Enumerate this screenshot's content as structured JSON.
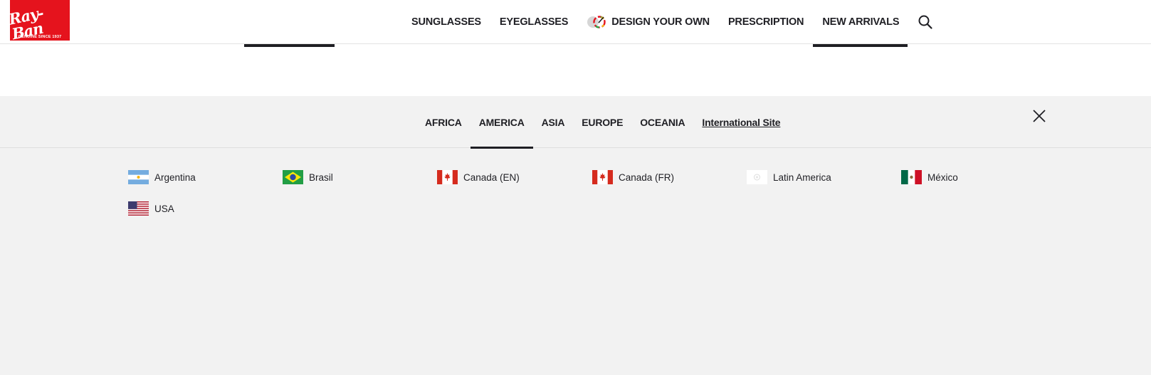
{
  "header": {
    "logo": {
      "script": "Ray-Ban",
      "tagline": "GENUINE SINCE 1937"
    },
    "nav": [
      {
        "label": "SUNGLASSES"
      },
      {
        "label": "EYEGLASSES"
      },
      {
        "label": "DESIGN YOUR OWN",
        "icon": "design-your-own-icon"
      },
      {
        "label": "PRESCRIPTION"
      },
      {
        "label": "NEW ARRIVALS"
      }
    ],
    "search_icon": "search-icon"
  },
  "region_panel": {
    "tabs": [
      {
        "label": "AFRICA"
      },
      {
        "label": "AMERICA",
        "active": true
      },
      {
        "label": "ASIA"
      },
      {
        "label": "EUROPE"
      },
      {
        "label": "OCEANIA"
      },
      {
        "label": "International Site",
        "link": true
      }
    ],
    "close_icon": "close-icon",
    "countries": [
      {
        "label": "Argentina",
        "flag": "argentina-flag-icon"
      },
      {
        "label": "Brasil",
        "flag": "brazil-flag-icon"
      },
      {
        "label": "Canada (EN)",
        "flag": "canada-flag-icon"
      },
      {
        "label": "Canada (FR)",
        "flag": "canada-flag-icon"
      },
      {
        "label": "Latin America",
        "flag": "latin-america-flag-icon"
      },
      {
        "label": "México",
        "flag": "mexico-flag-icon"
      },
      {
        "label": "USA",
        "flag": "usa-flag-icon"
      }
    ]
  },
  "colors": {
    "brand_red": "#e5131d",
    "text": "#1f1f24",
    "panel_bg": "#f2f2f2"
  }
}
